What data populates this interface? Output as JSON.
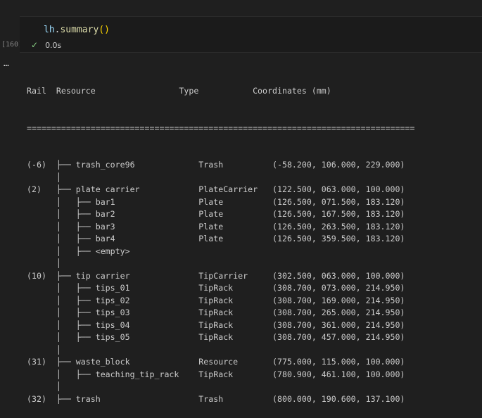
{
  "cell": {
    "execution_count": "[160]",
    "code": {
      "var": "lh",
      "dot": ".",
      "fn": "summary",
      "paren": "()"
    },
    "status": {
      "icon": "check-icon",
      "duration": "0.0s"
    }
  },
  "output": {
    "more_icon": "…",
    "header": "Rail  Resource                 Type           Coordinates (mm)",
    "separator": "===============================================================================",
    "lines": [
      "(-6)  ├── trash_core96             Trash          (-58.200, 106.000, 229.000)",
      "      │",
      "(2)   ├── plate carrier            PlateCarrier   (122.500, 063.000, 100.000)",
      "      │   ├── bar1                 Plate          (126.500, 071.500, 183.120)",
      "      │   ├── bar2                 Plate          (126.500, 167.500, 183.120)",
      "      │   ├── bar3                 Plate          (126.500, 263.500, 183.120)",
      "      │   ├── bar4                 Plate          (126.500, 359.500, 183.120)",
      "      │   ├── <empty>",
      "      │",
      "(10)  ├── tip carrier              TipCarrier     (302.500, 063.000, 100.000)",
      "      │   ├── tips_01              TipRack        (308.700, 073.000, 214.950)",
      "      │   ├── tips_02              TipRack        (308.700, 169.000, 214.950)",
      "      │   ├── tips_03              TipRack        (308.700, 265.000, 214.950)",
      "      │   ├── tips_04              TipRack        (308.700, 361.000, 214.950)",
      "      │   ├── tips_05              TipRack        (308.700, 457.000, 214.950)",
      "      │",
      "(31)  ├── waste_block              Resource       (775.000, 115.000, 100.000)",
      "      │   ├── teaching_tip_rack    TipRack        (780.900, 461.100, 100.000)",
      "      │",
      "(32)  ├── trash                    Trash          (800.000, 190.600, 137.100)"
    ]
  }
}
